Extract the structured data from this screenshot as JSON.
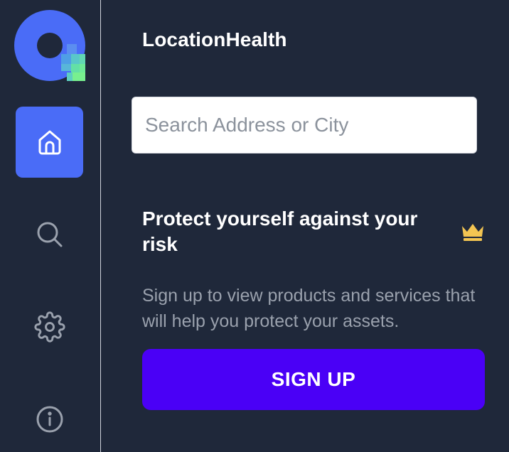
{
  "app": {
    "title": "LocationHealth"
  },
  "sidebar": {
    "logo_icon": "brand-logo-icon",
    "items": [
      {
        "id": "home",
        "icon": "home-icon",
        "active": true
      },
      {
        "id": "search",
        "icon": "search-icon",
        "active": false
      },
      {
        "id": "settings",
        "icon": "gear-icon",
        "active": false
      },
      {
        "id": "info",
        "icon": "info-icon",
        "active": false
      }
    ]
  },
  "search": {
    "placeholder": "Search Address or City",
    "value": ""
  },
  "promo": {
    "heading": "Protect yourself against your risk",
    "icon": "crown-icon",
    "description": "Sign up to view products and services that will help you protect your assets.",
    "button_label": "SIGN UP"
  },
  "colors": {
    "background": "#1f283a",
    "active_nav": "#4a6cf7",
    "button": "#4a00f6",
    "crown": "#f3c552",
    "muted_text": "#9aa1ad"
  }
}
